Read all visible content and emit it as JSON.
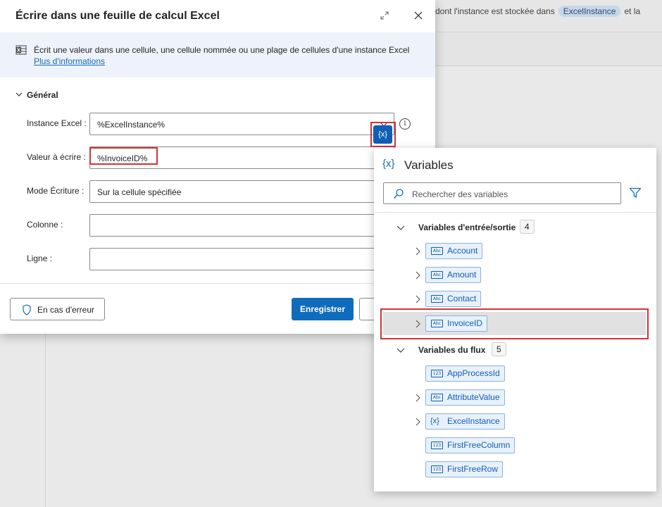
{
  "background": {
    "text_before": "dont l'instance est stockée dans",
    "chip": "ExcelInstance",
    "text_after": "et la"
  },
  "dialog": {
    "title": "Écrire dans une feuille de calcul Excel",
    "description": "Écrit une valeur dans une cellule, une cellule nommée ou une plage de cellules d'une instance Excel",
    "more_info": "Plus d'informations",
    "section": "Général",
    "fields": [
      {
        "label": "Instance Excel :",
        "value": "%ExcelInstance%"
      },
      {
        "label": "Valeur à écrire :",
        "value": "%InvoiceID%"
      },
      {
        "label": "Mode Écriture :",
        "value": "Sur la cellule spécifiée"
      },
      {
        "label": "Colonne :",
        "value": ""
      },
      {
        "label": "Ligne :",
        "value": ""
      }
    ],
    "var_button": "{x}",
    "info_icon": "i",
    "on_error_label": "En cas d'erreur",
    "save_label": "Enregistrer"
  },
  "variables_panel": {
    "icon": "{x}",
    "title": "Variables",
    "search_placeholder": "Rechercher des variables",
    "groups": [
      {
        "title": "Variables d'entrée/sortie",
        "count": "4",
        "items": [
          {
            "name": "Account",
            "type_icon": "text-var-icon"
          },
          {
            "name": "Amount",
            "type_icon": "text-var-icon"
          },
          {
            "name": "Contact",
            "type_icon": "text-var-icon"
          },
          {
            "name": "InvoiceID",
            "type_icon": "text-var-icon",
            "selected": true
          }
        ]
      },
      {
        "title": "Variables du flux",
        "count": "5",
        "items": [
          {
            "name": "AppProcessId",
            "type_icon": "number-var-icon"
          },
          {
            "name": "AttributeValue",
            "type_icon": "text-var-icon"
          },
          {
            "name": "ExcelInstance",
            "type_icon": "instance-var-icon"
          },
          {
            "name": "FirstFreeColumn",
            "type_icon": "number-var-icon"
          },
          {
            "name": "FirstFreeRow",
            "type_icon": "number-var-icon"
          }
        ]
      }
    ],
    "type_glyphs": {
      "text": "Abc",
      "number": "123",
      "instance": "{x}"
    }
  },
  "colors": {
    "accent": "#0f6cbd",
    "highlight": "#d13438",
    "selected_row": "#e1e1e1"
  }
}
